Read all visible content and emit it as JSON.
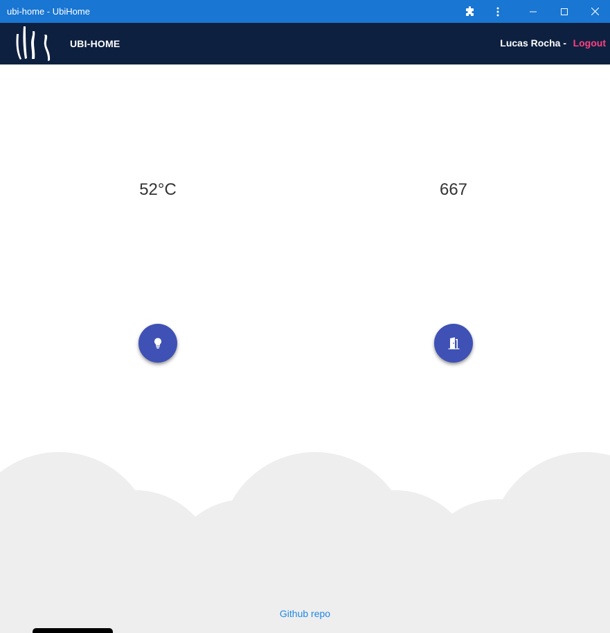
{
  "window": {
    "title": "ubi-home - UbiHome",
    "icons": [
      "puzzle-icon",
      "kebab-menu-icon",
      "minimize-icon",
      "maximize-icon",
      "close-icon"
    ]
  },
  "appbar": {
    "brand": "UBI-HOME",
    "user": "Lucas Rocha -",
    "logout": "Logout",
    "colors": {
      "background": "#0e203f",
      "logout": "#ff4081"
    }
  },
  "readings": {
    "temperature": "52°C",
    "count": "667"
  },
  "actions": {
    "light_icon": "lightbulb-icon",
    "door_icon": "door-icon",
    "color": "#3f51b5"
  },
  "footer": {
    "link": "Github repo",
    "cloud_color": "#eeeeee"
  }
}
